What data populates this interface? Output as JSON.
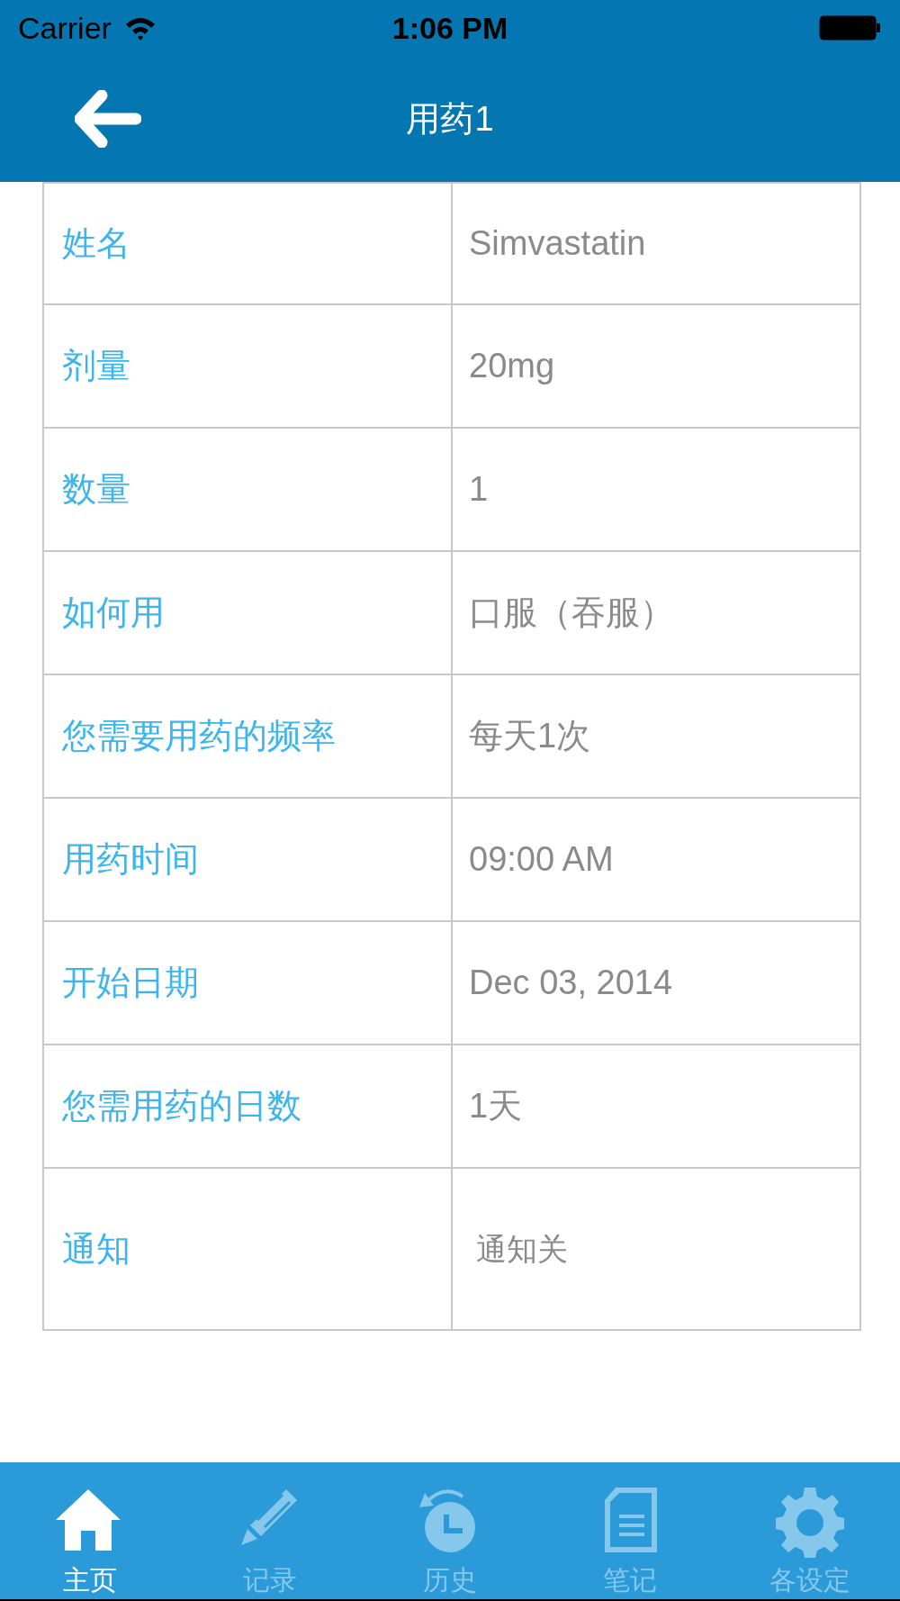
{
  "status_bar": {
    "carrier": "Carrier",
    "time": "1:06 PM"
  },
  "header": {
    "title": "用药1"
  },
  "rows": [
    {
      "label": "姓名",
      "value": "Simvastatin"
    },
    {
      "label": "剂量",
      "value": "20mg"
    },
    {
      "label": "数量",
      "value": "1"
    },
    {
      "label": "如何用",
      "value": "口服（吞服）"
    },
    {
      "label": "您需要用药的频率",
      "value": "每天1次"
    },
    {
      "label": "用药时间",
      "value": "09:00 AM"
    },
    {
      "label": "开始日期",
      "value": "Dec 03, 2014"
    },
    {
      "label": "您需用药的日数",
      "value": "1天"
    },
    {
      "label": "通知",
      "value": "通知关",
      "kind": "tall"
    }
  ],
  "tabs": [
    {
      "label": "主页",
      "kind": "home",
      "selected": true
    },
    {
      "label": "记录",
      "kind": "pencil",
      "selected": false
    },
    {
      "label": "历史",
      "kind": "history",
      "selected": false
    },
    {
      "label": "笔记",
      "kind": "note",
      "selected": false
    },
    {
      "label": "各设定",
      "kind": "gear",
      "selected": false
    }
  ]
}
